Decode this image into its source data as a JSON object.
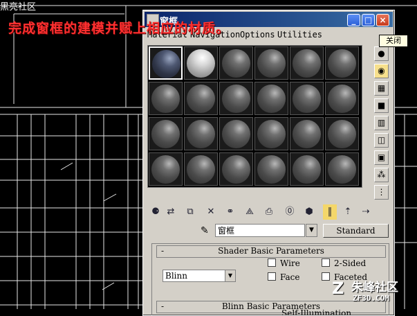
{
  "caption": "完成窗框的建模并赋上相应的材质。",
  "top_watermark": "黑亮社区",
  "close_tooltip": "关闭",
  "window": {
    "title": "窗框"
  },
  "menu": [
    "Material",
    "Navigation",
    "Options",
    "Utilities"
  ],
  "material_name": "窗框",
  "material_type": "Standard",
  "rollout_shader": "Shader Basic Parameters",
  "rollout_blinn": "Blinn Basic Parameters",
  "shader_value": "Blinn",
  "checkboxes": {
    "wire": "Wire",
    "two_sided": "2-Sided",
    "face_map": "Face",
    "faceted": "Faceted"
  },
  "self_illumination": "Self-Illumination",
  "bottom_watermark": {
    "brand": "朱峰社区",
    "url": "ZF3D.COM"
  }
}
